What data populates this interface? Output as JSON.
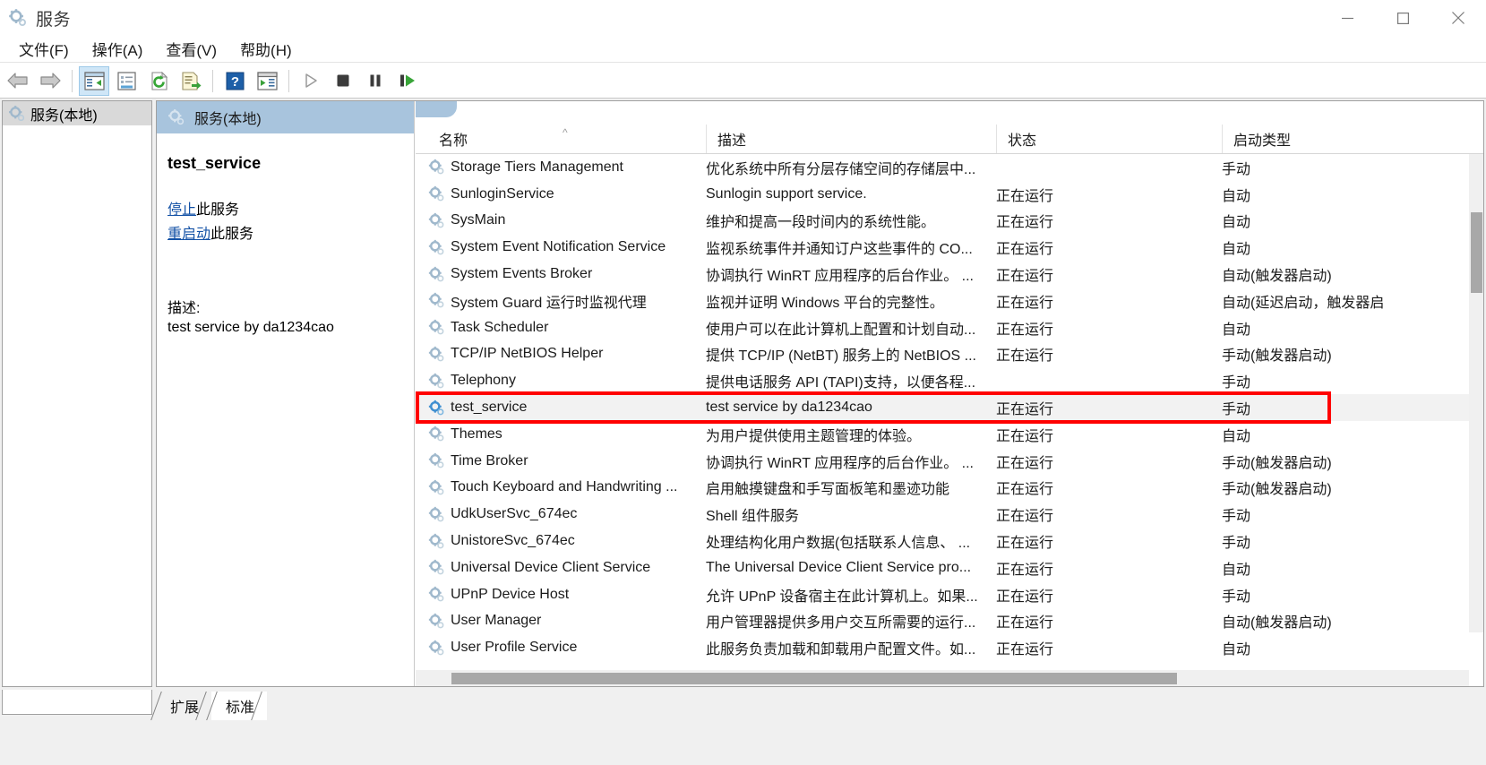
{
  "window": {
    "title": "服务",
    "app_icon": "services-gear-icon",
    "controls": {
      "minimize": "minimize-icon",
      "maximize": "maximize-icon",
      "close": "close-icon"
    }
  },
  "menu": {
    "items": [
      {
        "label": "文件(F)",
        "name": "menu-file"
      },
      {
        "label": "操作(A)",
        "name": "menu-action"
      },
      {
        "label": "查看(V)",
        "name": "menu-view"
      },
      {
        "label": "帮助(H)",
        "name": "menu-help"
      }
    ]
  },
  "toolbar": {
    "buttons": [
      {
        "name": "back-icon"
      },
      {
        "name": "forward-icon"
      },
      {
        "name": "show-hide-console-tree-icon"
      },
      {
        "name": "properties-icon"
      },
      {
        "name": "refresh-icon"
      },
      {
        "name": "export-list-icon"
      },
      {
        "name": "help-icon"
      },
      {
        "name": "show-action-pane-icon"
      },
      {
        "name": "start-service-icon"
      },
      {
        "name": "stop-service-icon"
      },
      {
        "name": "pause-service-icon"
      },
      {
        "name": "restart-service-icon"
      }
    ]
  },
  "tree": {
    "root_label": "服务(本地)",
    "root_icon": "services-gear-icon"
  },
  "details": {
    "header_label": "服务(本地)",
    "header_icon": "services-gear-icon",
    "service_name": "test_service",
    "links": [
      {
        "link_text": "停止",
        "suffix": "此服务",
        "name": "stop-service-link"
      },
      {
        "link_text": "重启动",
        "suffix": "此服务",
        "name": "restart-service-link"
      }
    ],
    "description_label": "描述:",
    "description_text": "test service by da1234cao"
  },
  "list": {
    "columns": [
      {
        "label": "名称",
        "name": "column-header-name",
        "sorted": "asc"
      },
      {
        "label": "描述",
        "name": "column-header-description"
      },
      {
        "label": "状态",
        "name": "column-header-status"
      },
      {
        "label": "启动类型",
        "name": "column-header-startup-type"
      }
    ],
    "rows": [
      {
        "name": "Storage Tiers Management",
        "description": "优化系统中所有分层存储空间的存储层中...",
        "status": "",
        "startup": "手动",
        "selected": false
      },
      {
        "name": "SunloginService",
        "description": "Sunlogin support service.",
        "status": "正在运行",
        "startup": "自动",
        "selected": false
      },
      {
        "name": "SysMain",
        "description": "维护和提高一段时间内的系统性能。",
        "status": "正在运行",
        "startup": "自动",
        "selected": false
      },
      {
        "name": "System Event Notification Service",
        "description": "监视系统事件并通知订户这些事件的 CO...",
        "status": "正在运行",
        "startup": "自动",
        "selected": false
      },
      {
        "name": "System Events Broker",
        "description": "协调执行 WinRT 应用程序的后台作业。 ...",
        "status": "正在运行",
        "startup": "自动(触发器启动)",
        "selected": false
      },
      {
        "name": "System Guard 运行时监视代理",
        "description": "监视并证明 Windows 平台的完整性。",
        "status": "正在运行",
        "startup": "自动(延迟启动，触发器启",
        "selected": false
      },
      {
        "name": "Task Scheduler",
        "description": "使用户可以在此计算机上配置和计划自动...",
        "status": "正在运行",
        "startup": "自动",
        "selected": false
      },
      {
        "name": "TCP/IP NetBIOS Helper",
        "description": "提供 TCP/IP (NetBT) 服务上的 NetBIOS ...",
        "status": "正在运行",
        "startup": "手动(触发器启动)",
        "selected": false
      },
      {
        "name": "Telephony",
        "description": "提供电话服务 API (TAPI)支持，以便各程...",
        "status": "",
        "startup": "手动",
        "selected": false
      },
      {
        "name": "test_service",
        "description": "test service by da1234cao",
        "status": "正在运行",
        "startup": "手动",
        "selected": true
      },
      {
        "name": "Themes",
        "description": "为用户提供使用主题管理的体验。",
        "status": "正在运行",
        "startup": "自动",
        "selected": false
      },
      {
        "name": "Time Broker",
        "description": "协调执行 WinRT 应用程序的后台作业。 ...",
        "status": "正在运行",
        "startup": "手动(触发器启动)",
        "selected": false
      },
      {
        "name": "Touch Keyboard and Handwriting ...",
        "description": "启用触摸键盘和手写面板笔和墨迹功能",
        "status": "正在运行",
        "startup": "手动(触发器启动)",
        "selected": false
      },
      {
        "name": "UdkUserSvc_674ec",
        "description": "Shell 组件服务",
        "status": "正在运行",
        "startup": "手动",
        "selected": false
      },
      {
        "name": "UnistoreSvc_674ec",
        "description": "处理结构化用户数据(包括联系人信息、 ...",
        "status": "正在运行",
        "startup": "手动",
        "selected": false
      },
      {
        "name": "Universal Device Client Service",
        "description": "The Universal Device Client Service pro...",
        "status": "正在运行",
        "startup": "自动",
        "selected": false
      },
      {
        "name": "UPnP Device Host",
        "description": "允许 UPnP 设备宿主在此计算机上。如果...",
        "status": "正在运行",
        "startup": "手动",
        "selected": false
      },
      {
        "name": "User Manager",
        "description": "用户管理器提供多用户交互所需要的运行...",
        "status": "正在运行",
        "startup": "自动(触发器启动)",
        "selected": false
      },
      {
        "name": "User Profile Service",
        "description": "此服务负责加载和卸载用户配置文件。如...",
        "status": "正在运行",
        "startup": "自动",
        "selected": false
      }
    ]
  },
  "bottom_tabs": [
    {
      "label": "扩展",
      "name": "tab-extended",
      "active": false
    },
    {
      "label": "标准",
      "name": "tab-standard",
      "active": true
    }
  ],
  "colors": {
    "highlight_box": "#ff0000",
    "details_header": "#a8c4dd",
    "link": "#1452a6",
    "selected_row": "#f2f2f2"
  }
}
